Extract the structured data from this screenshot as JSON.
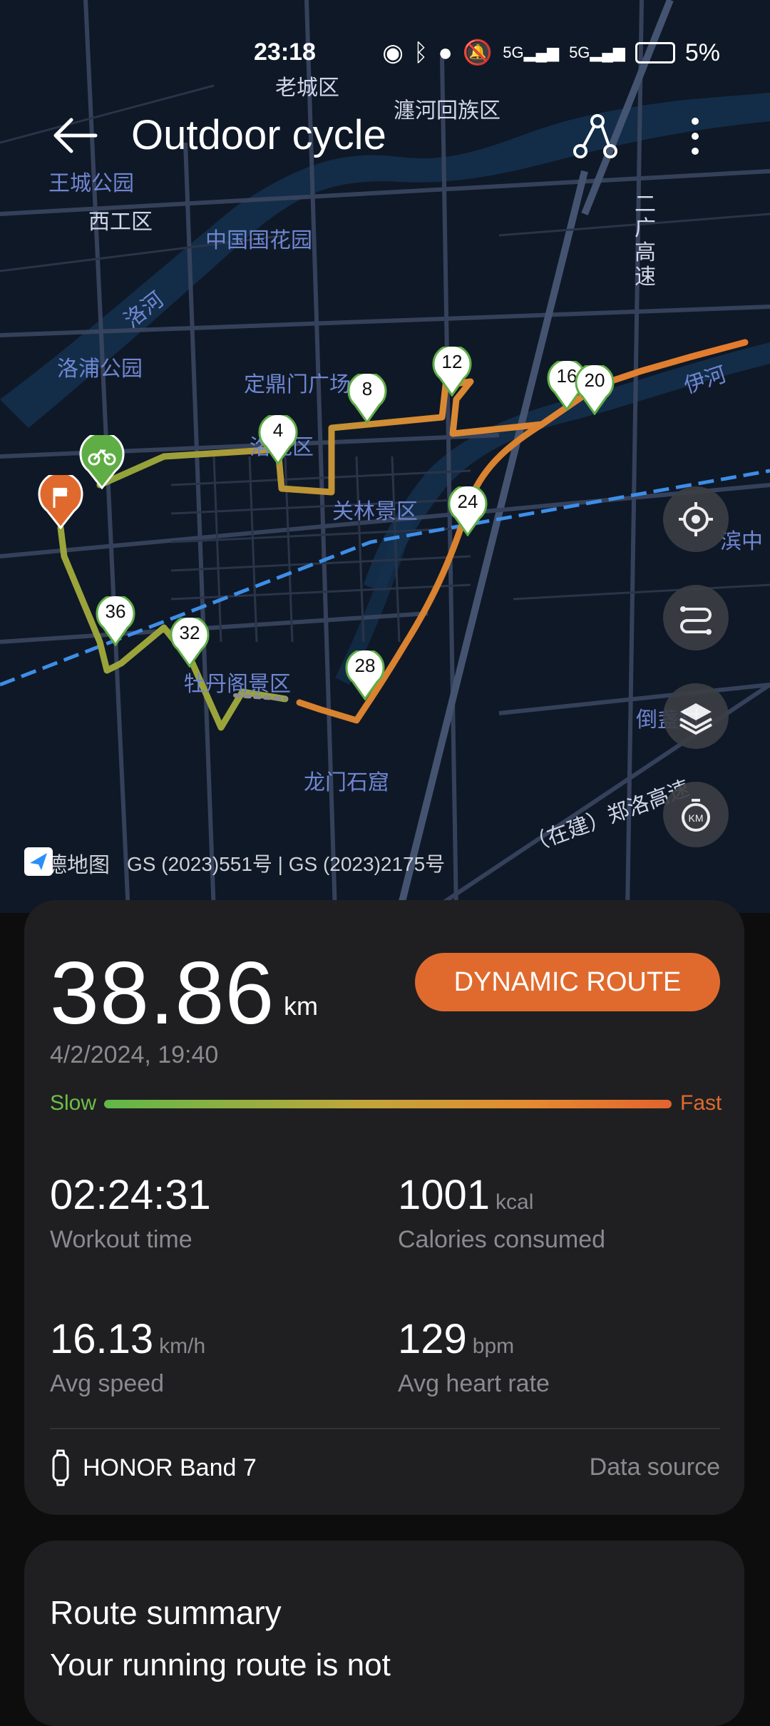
{
  "status_bar": {
    "time": "23:18",
    "network_1": "5G",
    "network_2": "5G",
    "battery": "5%"
  },
  "header": {
    "title": "Outdoor cycle"
  },
  "map": {
    "labels": {
      "laocheng": "老城区",
      "chanhe": "瀍河回族区",
      "wangcheng": "王城公园",
      "xigong": "西工区",
      "zhongguo": "中国国花园",
      "luohe": "洛河",
      "erguang": "二广高速",
      "luopu": "洛浦公园",
      "dingding": "定鼎门广场",
      "luolong": "洛龙区",
      "guanlin": "关林景区",
      "yihe": "伊河",
      "binhe": "滨中",
      "mudan": "牡丹阁景区",
      "longmen": "龙门石窟",
      "daocun": "倒盏村",
      "zaijian": "（在建）郑洛高速"
    },
    "markers": [
      "4",
      "8",
      "12",
      "16",
      "20",
      "24",
      "28",
      "32",
      "36"
    ],
    "attribution": {
      "provider": "高德地图",
      "license": "GS (2023)551号 | GS (2023)2175号"
    }
  },
  "summary": {
    "distance": "38.86",
    "distance_unit": "km",
    "dynamic_route_label": "DYNAMIC ROUTE",
    "date": "4/2/2024, 19:40",
    "slow_label": "Slow",
    "fast_label": "Fast",
    "stats": {
      "workout_time": {
        "value": "02:24:31",
        "unit": "",
        "label": "Workout time"
      },
      "calories": {
        "value": "1001",
        "unit": "kcal",
        "label": "Calories consumed"
      },
      "avg_speed": {
        "value": "16.13",
        "unit": "km/h",
        "label": "Avg speed"
      },
      "avg_heart_rate": {
        "value": "129",
        "unit": "bpm",
        "label": "Avg heart rate"
      }
    },
    "device": "HONOR Band 7",
    "data_source_label": "Data source"
  },
  "route_summary": {
    "title": "Route summary",
    "text": "Your running route is not"
  },
  "colors": {
    "accent": "#e06a2d",
    "slow": "#6fbf4a",
    "card_bg": "#1f1f21"
  }
}
